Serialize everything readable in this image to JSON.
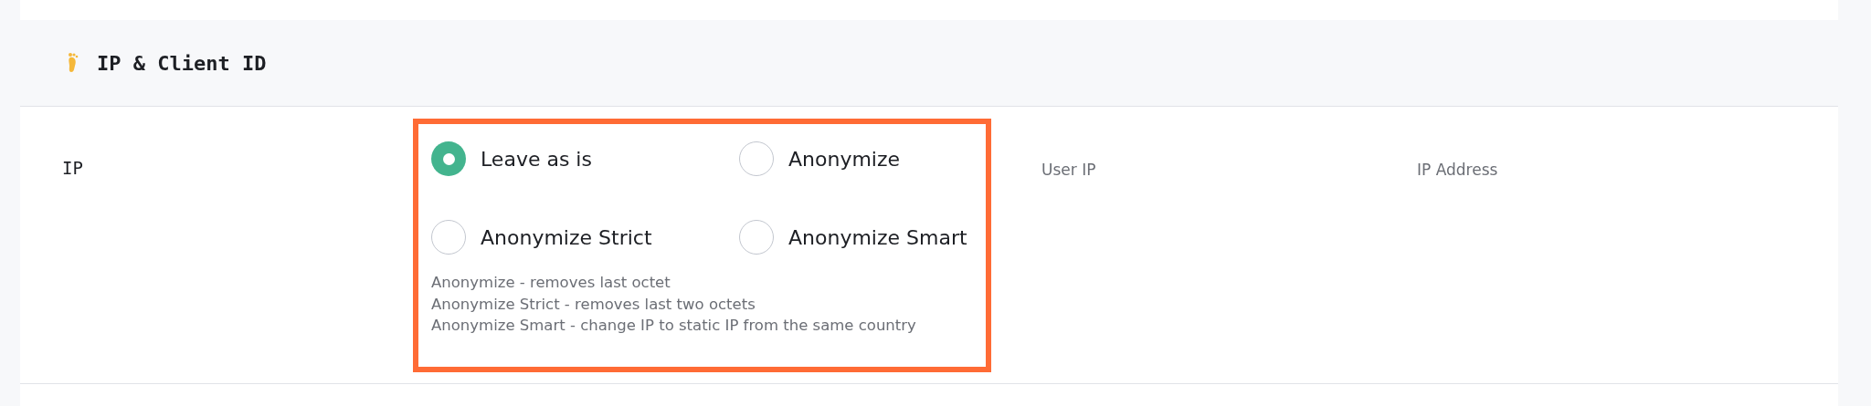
{
  "section": {
    "title": "IP & Client ID"
  },
  "row": {
    "label": "IP",
    "options": [
      {
        "label": "Leave as is",
        "selected": true
      },
      {
        "label": "Anonymize",
        "selected": false
      },
      {
        "label": "Anonymize Strict",
        "selected": false
      },
      {
        "label": "Anonymize Smart",
        "selected": false
      }
    ],
    "hints": [
      "Anonymize - removes last octet",
      "Anonymize Strict - removes last two octets",
      "Anonymize Smart - change IP to static IP from the same country"
    ],
    "column_3": "User IP",
    "column_4": "IP Address"
  }
}
